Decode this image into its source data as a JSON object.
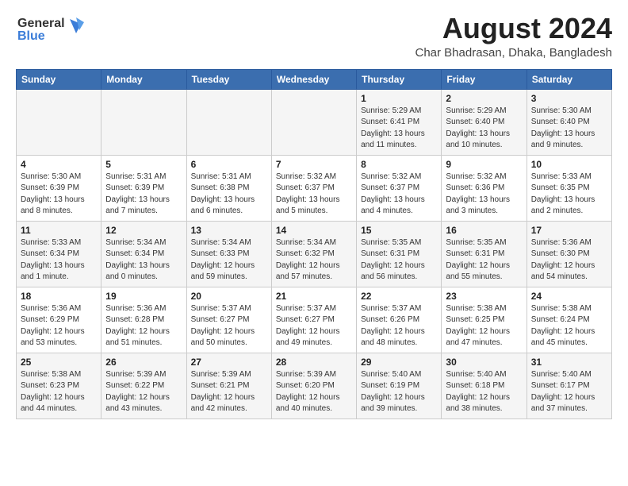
{
  "header": {
    "logo_line1": "General",
    "logo_line2": "Blue",
    "month_year": "August 2024",
    "location": "Char Bhadrasan, Dhaka, Bangladesh"
  },
  "weekdays": [
    "Sunday",
    "Monday",
    "Tuesday",
    "Wednesday",
    "Thursday",
    "Friday",
    "Saturday"
  ],
  "weeks": [
    [
      {
        "day": "",
        "info": ""
      },
      {
        "day": "",
        "info": ""
      },
      {
        "day": "",
        "info": ""
      },
      {
        "day": "",
        "info": ""
      },
      {
        "day": "1",
        "info": "Sunrise: 5:29 AM\nSunset: 6:41 PM\nDaylight: 13 hours\nand 11 minutes."
      },
      {
        "day": "2",
        "info": "Sunrise: 5:29 AM\nSunset: 6:40 PM\nDaylight: 13 hours\nand 10 minutes."
      },
      {
        "day": "3",
        "info": "Sunrise: 5:30 AM\nSunset: 6:40 PM\nDaylight: 13 hours\nand 9 minutes."
      }
    ],
    [
      {
        "day": "4",
        "info": "Sunrise: 5:30 AM\nSunset: 6:39 PM\nDaylight: 13 hours\nand 8 minutes."
      },
      {
        "day": "5",
        "info": "Sunrise: 5:31 AM\nSunset: 6:39 PM\nDaylight: 13 hours\nand 7 minutes."
      },
      {
        "day": "6",
        "info": "Sunrise: 5:31 AM\nSunset: 6:38 PM\nDaylight: 13 hours\nand 6 minutes."
      },
      {
        "day": "7",
        "info": "Sunrise: 5:32 AM\nSunset: 6:37 PM\nDaylight: 13 hours\nand 5 minutes."
      },
      {
        "day": "8",
        "info": "Sunrise: 5:32 AM\nSunset: 6:37 PM\nDaylight: 13 hours\nand 4 minutes."
      },
      {
        "day": "9",
        "info": "Sunrise: 5:32 AM\nSunset: 6:36 PM\nDaylight: 13 hours\nand 3 minutes."
      },
      {
        "day": "10",
        "info": "Sunrise: 5:33 AM\nSunset: 6:35 PM\nDaylight: 13 hours\nand 2 minutes."
      }
    ],
    [
      {
        "day": "11",
        "info": "Sunrise: 5:33 AM\nSunset: 6:34 PM\nDaylight: 13 hours\nand 1 minute."
      },
      {
        "day": "12",
        "info": "Sunrise: 5:34 AM\nSunset: 6:34 PM\nDaylight: 13 hours\nand 0 minutes."
      },
      {
        "day": "13",
        "info": "Sunrise: 5:34 AM\nSunset: 6:33 PM\nDaylight: 12 hours\nand 59 minutes."
      },
      {
        "day": "14",
        "info": "Sunrise: 5:34 AM\nSunset: 6:32 PM\nDaylight: 12 hours\nand 57 minutes."
      },
      {
        "day": "15",
        "info": "Sunrise: 5:35 AM\nSunset: 6:31 PM\nDaylight: 12 hours\nand 56 minutes."
      },
      {
        "day": "16",
        "info": "Sunrise: 5:35 AM\nSunset: 6:31 PM\nDaylight: 12 hours\nand 55 minutes."
      },
      {
        "day": "17",
        "info": "Sunrise: 5:36 AM\nSunset: 6:30 PM\nDaylight: 12 hours\nand 54 minutes."
      }
    ],
    [
      {
        "day": "18",
        "info": "Sunrise: 5:36 AM\nSunset: 6:29 PM\nDaylight: 12 hours\nand 53 minutes."
      },
      {
        "day": "19",
        "info": "Sunrise: 5:36 AM\nSunset: 6:28 PM\nDaylight: 12 hours\nand 51 minutes."
      },
      {
        "day": "20",
        "info": "Sunrise: 5:37 AM\nSunset: 6:27 PM\nDaylight: 12 hours\nand 50 minutes."
      },
      {
        "day": "21",
        "info": "Sunrise: 5:37 AM\nSunset: 6:27 PM\nDaylight: 12 hours\nand 49 minutes."
      },
      {
        "day": "22",
        "info": "Sunrise: 5:37 AM\nSunset: 6:26 PM\nDaylight: 12 hours\nand 48 minutes."
      },
      {
        "day": "23",
        "info": "Sunrise: 5:38 AM\nSunset: 6:25 PM\nDaylight: 12 hours\nand 47 minutes."
      },
      {
        "day": "24",
        "info": "Sunrise: 5:38 AM\nSunset: 6:24 PM\nDaylight: 12 hours\nand 45 minutes."
      }
    ],
    [
      {
        "day": "25",
        "info": "Sunrise: 5:38 AM\nSunset: 6:23 PM\nDaylight: 12 hours\nand 44 minutes."
      },
      {
        "day": "26",
        "info": "Sunrise: 5:39 AM\nSunset: 6:22 PM\nDaylight: 12 hours\nand 43 minutes."
      },
      {
        "day": "27",
        "info": "Sunrise: 5:39 AM\nSunset: 6:21 PM\nDaylight: 12 hours\nand 42 minutes."
      },
      {
        "day": "28",
        "info": "Sunrise: 5:39 AM\nSunset: 6:20 PM\nDaylight: 12 hours\nand 40 minutes."
      },
      {
        "day": "29",
        "info": "Sunrise: 5:40 AM\nSunset: 6:19 PM\nDaylight: 12 hours\nand 39 minutes."
      },
      {
        "day": "30",
        "info": "Sunrise: 5:40 AM\nSunset: 6:18 PM\nDaylight: 12 hours\nand 38 minutes."
      },
      {
        "day": "31",
        "info": "Sunrise: 5:40 AM\nSunset: 6:17 PM\nDaylight: 12 hours\nand 37 minutes."
      }
    ]
  ]
}
